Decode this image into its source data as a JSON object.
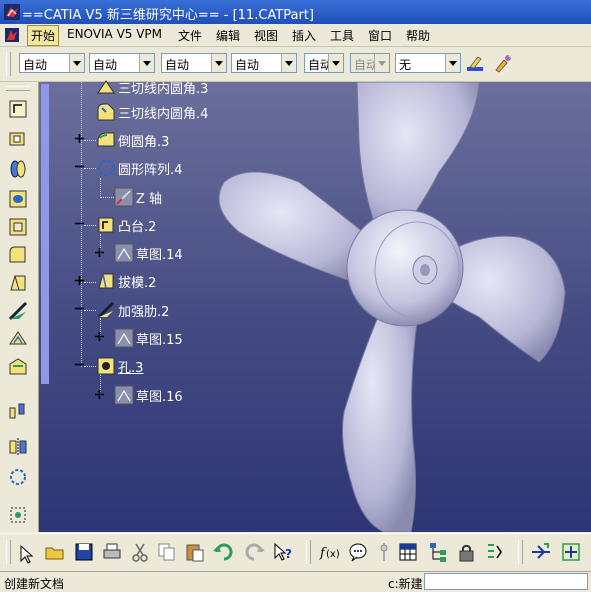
{
  "window": {
    "title": "==CATIA V5  新三维研究中心== - [11.CATPart]"
  },
  "menu": {
    "items": [
      {
        "label": "开始",
        "active": true
      },
      {
        "label": "ENOVIA V5 VPM"
      },
      {
        "label": "文件"
      },
      {
        "label": "编辑"
      },
      {
        "label": "视图"
      },
      {
        "label": "插入"
      },
      {
        "label": "工具"
      },
      {
        "label": "窗口"
      },
      {
        "label": "帮助"
      }
    ]
  },
  "graphic_toolbar": {
    "combos": [
      {
        "value": "自动",
        "disabled": false
      },
      {
        "value": "自动",
        "disabled": false
      },
      {
        "value": "自动",
        "disabled": false
      },
      {
        "value": "自动",
        "disabled": false
      },
      {
        "value": "自动",
        "disabled": false
      },
      {
        "value": "自动",
        "disabled": true
      },
      {
        "value": "无",
        "disabled": false
      }
    ],
    "icons": [
      "paint-brush-icon",
      "format-painter-icon"
    ]
  },
  "tree": {
    "items": [
      {
        "label": "三切线内圆角.3",
        "icon": "tritangent-fillet-icon"
      },
      {
        "label": "三切线内圆角.4",
        "icon": "tritangent-fillet-icon"
      },
      {
        "label": "倒圆角.3",
        "icon": "edge-fillet-icon"
      },
      {
        "label": "圆形阵列.4",
        "icon": "circular-pattern-icon"
      },
      {
        "label": "Z 轴",
        "icon": "axis-icon"
      },
      {
        "label": "凸台.2",
        "icon": "pad-icon"
      },
      {
        "label": "草图.14",
        "icon": "sketch-icon"
      },
      {
        "label": "拔模.2",
        "icon": "draft-icon"
      },
      {
        "label": "加强肋.2",
        "icon": "rib-icon"
      },
      {
        "label": "草图.15",
        "icon": "sketch-icon"
      },
      {
        "label": "孔.3",
        "icon": "hole-icon"
      },
      {
        "label": "草图.16",
        "icon": "sketch-icon"
      }
    ]
  },
  "left_toolbar": {
    "icons": [
      "sketcher-icon",
      "pad-icon",
      "shaft-icon",
      "hole-icon",
      "pocket-icon",
      "fillet-icon",
      "draft-icon",
      "rib-icon",
      "shell-icon",
      "thickness-icon",
      "transform-icon",
      "mirror-icon",
      "pattern-icon",
      "scaling-icon"
    ]
  },
  "bottom_toolbar": {
    "icons": [
      "select-arrow-icon",
      "open-folder-icon",
      "save-icon",
      "print-icon",
      "cut-icon",
      "copy-icon",
      "paste-icon",
      "undo-icon",
      "redo-icon",
      "help-icon",
      "formula-icon",
      "knowledge-advisor-icon",
      "parameter-icon",
      "table-icon",
      "tree-view-icon",
      "lock-icon",
      "list-icon",
      "fly-mode-icon",
      "fit-all-icon"
    ]
  },
  "status": {
    "text": "创建新文档",
    "prompt": "c:新建",
    "input_value": ""
  }
}
